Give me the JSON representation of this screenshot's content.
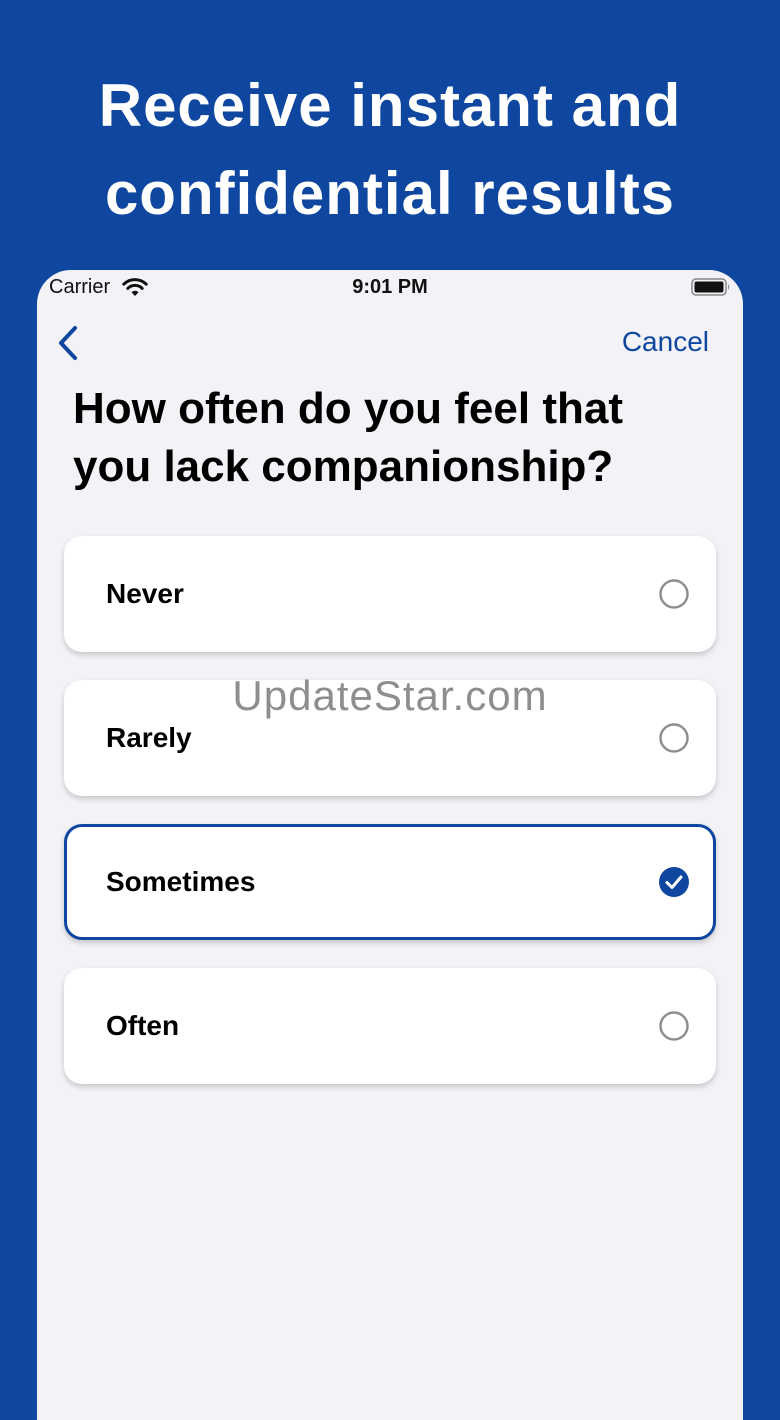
{
  "headline": {
    "line1": "Receive instant and",
    "line2": "confidential results"
  },
  "status_bar": {
    "carrier": "Carrier",
    "time": "9:01 PM",
    "wifi_icon": "wifi-icon",
    "battery_icon": "battery-icon"
  },
  "nav": {
    "back_icon": "chevron-left-icon",
    "cancel_label": "Cancel"
  },
  "question": {
    "text": "How often do you feel that you lack companionship?"
  },
  "options": [
    {
      "label": "Never",
      "selected": false
    },
    {
      "label": "Rarely",
      "selected": false
    },
    {
      "label": "Sometimes",
      "selected": true
    },
    {
      "label": "Often",
      "selected": false
    }
  ],
  "watermark": "UpdateStar.com",
  "colors": {
    "brand_blue": "#0f46a0",
    "screen_bg": "#f2f2f7",
    "card_bg": "#ffffff",
    "radio_unselected": "#8e8e93"
  }
}
